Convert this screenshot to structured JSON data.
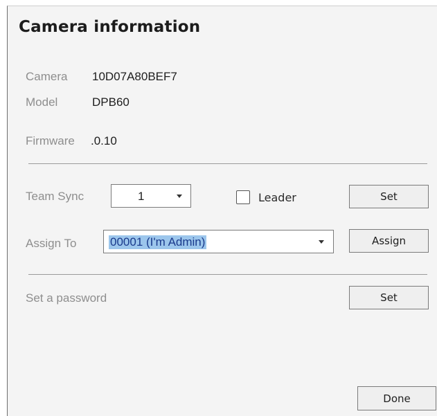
{
  "dialog": {
    "title": "Camera information"
  },
  "info": {
    "camera_label": "Camera",
    "camera_value": "10D07A80BEF7",
    "model_label": "Model",
    "model_value": "DPB60",
    "firmware_label": "Firmware",
    "firmware_value": ".0.10"
  },
  "team_sync": {
    "label": "Team Sync",
    "selected": "1",
    "leader_label": "Leader",
    "leader_checked": false,
    "set_label": "Set"
  },
  "assign": {
    "label": "Assign To",
    "selected": "00001 (I'm Admin)",
    "button_label": "Assign"
  },
  "password": {
    "label": "Set a password",
    "set_label": "Set"
  },
  "footer": {
    "done_label": "Done"
  },
  "icons": {
    "dropdown": "chevron-down-icon",
    "checkbox": "checkbox-icon"
  },
  "colors": {
    "dialog_bg": "#f4f4f4",
    "selection_highlight": "#9cc6ec",
    "button_bg": "#efefef"
  }
}
